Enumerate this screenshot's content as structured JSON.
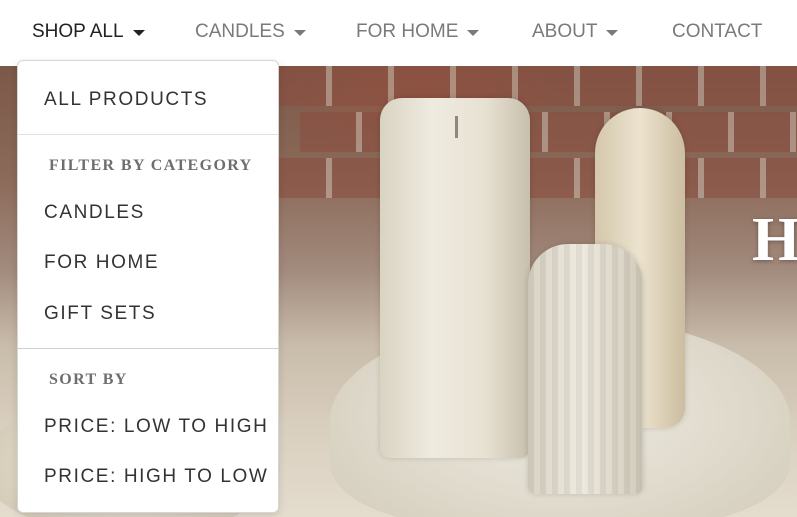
{
  "nav": {
    "items": [
      {
        "label": "SHOP ALL",
        "has_caret": true,
        "active": true
      },
      {
        "label": "CANDLES",
        "has_caret": true,
        "active": false
      },
      {
        "label": "FOR HOME",
        "has_caret": true,
        "active": false
      },
      {
        "label": "ABOUT",
        "has_caret": true,
        "active": false
      },
      {
        "label": "CONTACT",
        "has_caret": false,
        "active": false
      }
    ]
  },
  "dropdown": {
    "all_products": "ALL PRODUCTS",
    "filter_header": "FILTER BY CATEGORY",
    "categories": [
      "CANDLES",
      "FOR HOME",
      "GIFT SETS"
    ],
    "sort_header": "SORT BY",
    "sort_options": [
      "PRICE: LOW TO HIGH",
      "PRICE: HIGH TO LOW"
    ]
  },
  "hero": {
    "headline_partial": "H"
  },
  "colors": {
    "nav_text": "#7a7a7a",
    "nav_active_text": "#222222",
    "dropdown_text": "#333333",
    "dropdown_header": "#6e6e6e"
  }
}
